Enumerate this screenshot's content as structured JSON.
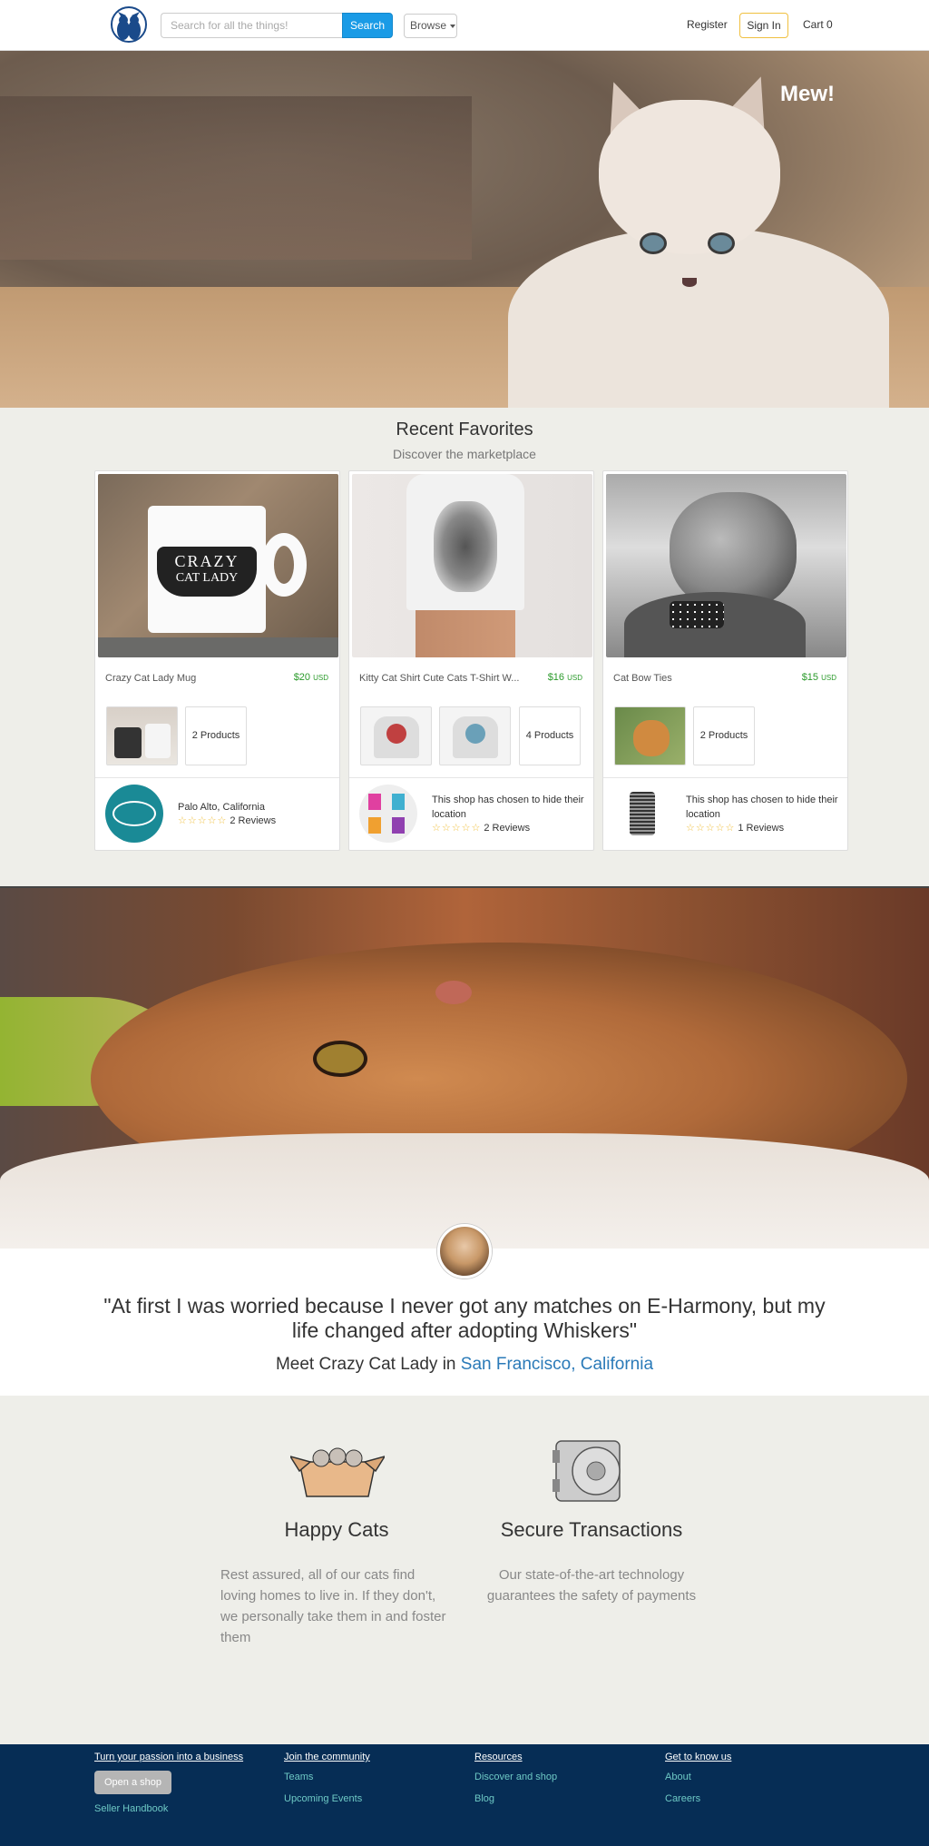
{
  "nav": {
    "search_placeholder": "Search for all the things!",
    "search_label": "Search",
    "browse_label": "Browse",
    "register_label": "Register",
    "signin_label": "Sign In",
    "cart_label": "Cart 0"
  },
  "hero": {
    "title": "Mew!"
  },
  "favorites": {
    "title": "Recent Favorites",
    "subtitle": "Discover the marketplace",
    "cards": [
      {
        "name": "Crazy Cat Lady Mug",
        "price": "$20",
        "currency": "USD",
        "products": "2 Products",
        "location": "Palo Alto, California",
        "reviews": "2 Reviews",
        "image_text_1": "CRAZY",
        "image_text_2": "CAT LADY"
      },
      {
        "name": "Kitty Cat Shirt Cute Cats T-Shirt W...",
        "price": "$16",
        "currency": "USD",
        "products": "4 Products",
        "location": "This shop has chosen to hide their location",
        "reviews": "2 Reviews"
      },
      {
        "name": "Cat Bow Ties",
        "price": "$15",
        "currency": "USD",
        "products": "2 Products",
        "location": "This shop has chosen to hide their location",
        "reviews": "1 Reviews"
      }
    ]
  },
  "testimonial": {
    "quote": "\"At first I was worried because I never got any matches on E-Harmony, but my life changed after adopting Whiskers\"",
    "meet_prefix": "Meet Crazy Cat Lady in",
    "meet_location": "San Francisco, California"
  },
  "features": [
    {
      "title": "Happy Cats",
      "text": "Rest assured, all of our cats find loving homes to live in. If they don't, we personally take them in and foster them"
    },
    {
      "title": "Secure Transactions",
      "text": "Our state-of-the-art technology guarantees the safety of payments"
    }
  ],
  "footer": {
    "col1": {
      "heading": "Turn your passion into a business",
      "button": "Open a shop",
      "link": "Seller Handbook"
    },
    "col2": {
      "heading": "Join the community",
      "links": [
        "Teams",
        "Upcoming Events"
      ]
    },
    "col3": {
      "heading": "Resources",
      "links": [
        "Discover and shop",
        "Blog"
      ]
    },
    "col4": {
      "heading": "Get to know us",
      "links": [
        "About",
        "Careers"
      ]
    }
  },
  "colors": {
    "accent": "#1a9be6",
    "price": "#2a9a2a",
    "footer_bg": "#062d55",
    "footer_link": "#6ec9c5",
    "link": "#2a7ab8"
  }
}
